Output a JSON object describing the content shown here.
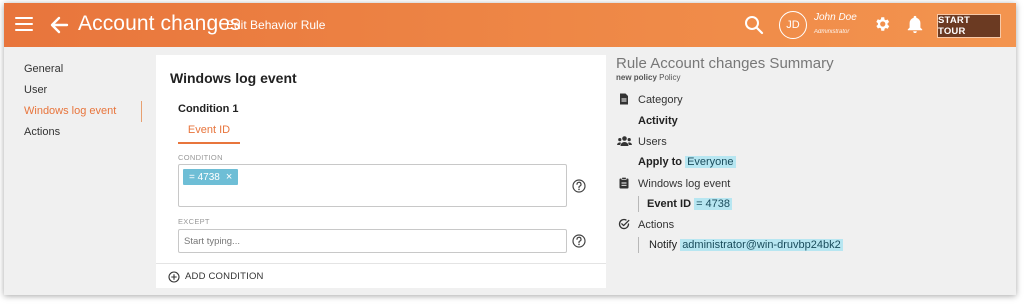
{
  "header": {
    "title": "Account changes",
    "subtitle": "Edit Behavior Rule",
    "avatar_initials": "JD",
    "user_name": "John Doe",
    "user_role": "Administrator",
    "start_tour_label": "START TOUR",
    "accent_color": "#e8753c"
  },
  "nav": {
    "items": [
      {
        "label": "General"
      },
      {
        "label": "User"
      },
      {
        "label": "Windows log event"
      },
      {
        "label": "Actions"
      }
    ],
    "active_index": 2
  },
  "card": {
    "title": "Windows log event",
    "condition_title": "Condition 1",
    "tab_label": "Event ID",
    "condition_label": "CONDITION",
    "condition_chip": "= 4738",
    "chip_close": "×",
    "except_label": "EXCEPT",
    "except_placeholder": "Start typing...",
    "add_condition_label": "ADD CONDITION",
    "chip_color": "#6ebed6"
  },
  "summary": {
    "title": "Rule Account changes Summary",
    "policy_name": "new policy",
    "policy_suffix": "Policy",
    "category": {
      "heading": "Category",
      "value": "Activity"
    },
    "users": {
      "heading": "Users",
      "prefix": "Apply to",
      "value": "Everyone"
    },
    "event": {
      "heading": "Windows log event",
      "prefix": "Event ID",
      "value": "= 4738"
    },
    "actions": {
      "heading": "Actions",
      "prefix": "Notify",
      "value": "administrator@win-druvbp24bk2"
    },
    "highlight_color": "#b7e6f1"
  }
}
